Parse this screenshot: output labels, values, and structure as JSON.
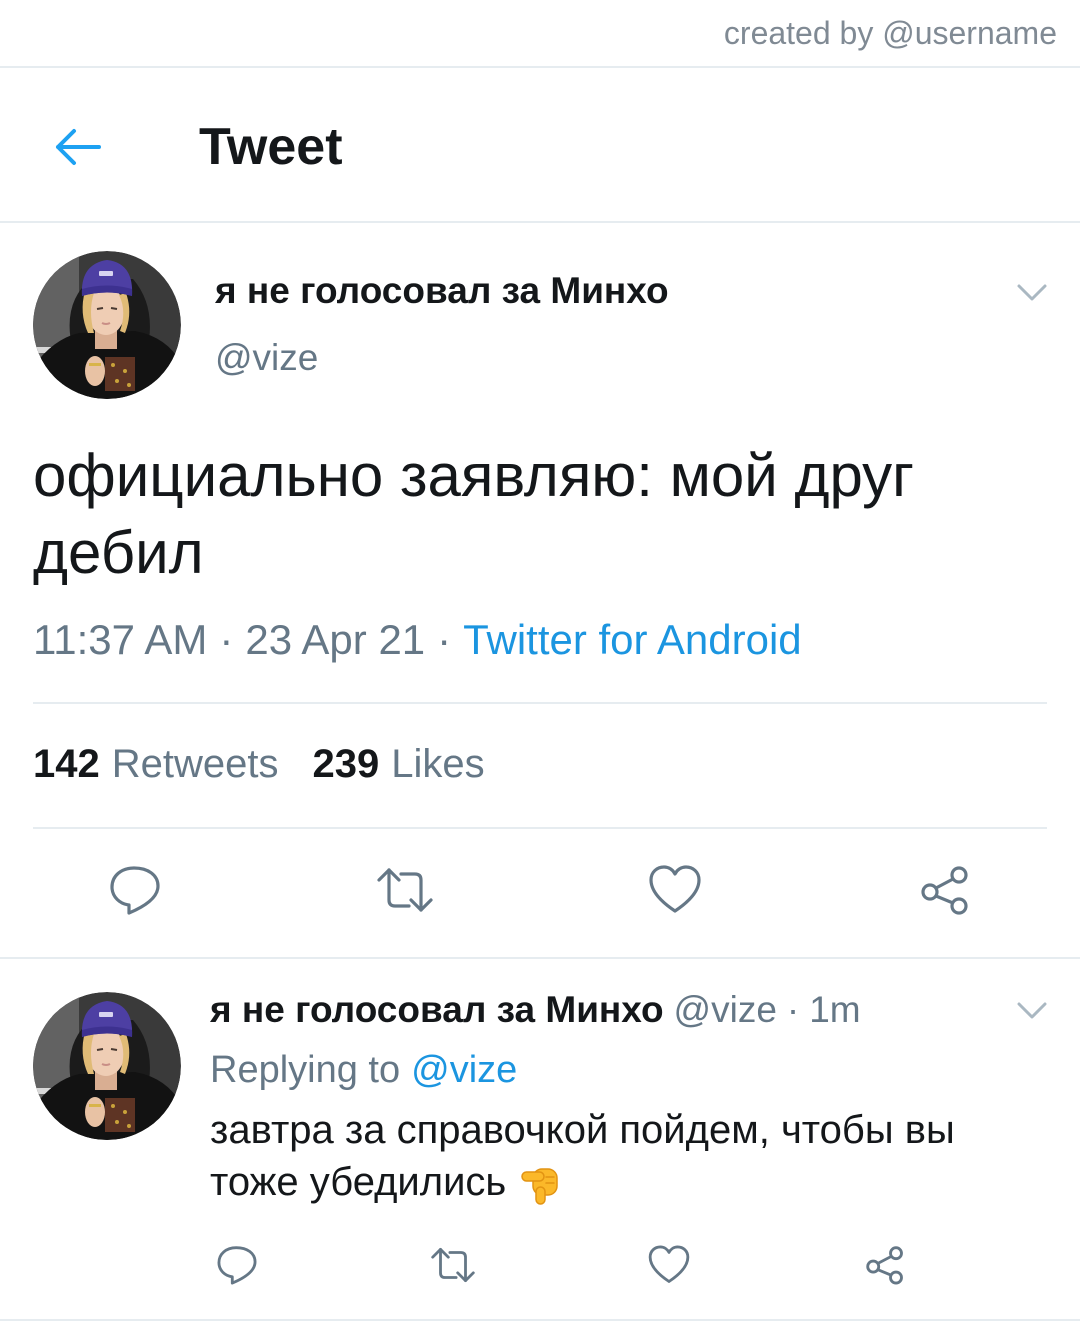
{
  "watermark": {
    "text": "created by @username"
  },
  "header": {
    "title": "Tweet",
    "back_icon": "back-arrow-icon"
  },
  "main_tweet": {
    "author_name": "я не голосовал за Минхо",
    "author_handle": "@vize",
    "text_lines": [
      "официально заявляю: мой друг",
      "дебил"
    ],
    "time": "11:37 AM",
    "separator": "·",
    "date": "23 Apr 21",
    "source": "Twitter for Android",
    "stats": {
      "retweets_count": "142",
      "retweets_label": "Retweets",
      "likes_count": "239",
      "likes_label": "Likes"
    },
    "actions": [
      "reply-icon",
      "retweet-icon",
      "like-icon",
      "share-icon"
    ],
    "menu_icon": "chevron-down-icon"
  },
  "reply_tweet": {
    "author_name": "я не голосовал за Минхо",
    "author_handle": "@vize",
    "separator": "·",
    "age": "1m",
    "replying_to_label": "Replying to",
    "replying_to_handle": "@vize",
    "text_lines": [
      "завтра за справочкой пойдем, чтобы вы",
      "тоже убедились"
    ],
    "emoji_icon": "hand-emoji-icon",
    "actions": [
      "reply-icon",
      "retweet-icon",
      "like-icon",
      "share-icon"
    ],
    "menu_icon": "chevron-down-icon"
  },
  "colors": {
    "accent": "#1da1f2",
    "link": "#1b95e0",
    "text_primary": "#14171a",
    "text_secondary": "#657786",
    "divider": "#e6ecf0",
    "avatar_beanie": "#4d3fa3"
  }
}
